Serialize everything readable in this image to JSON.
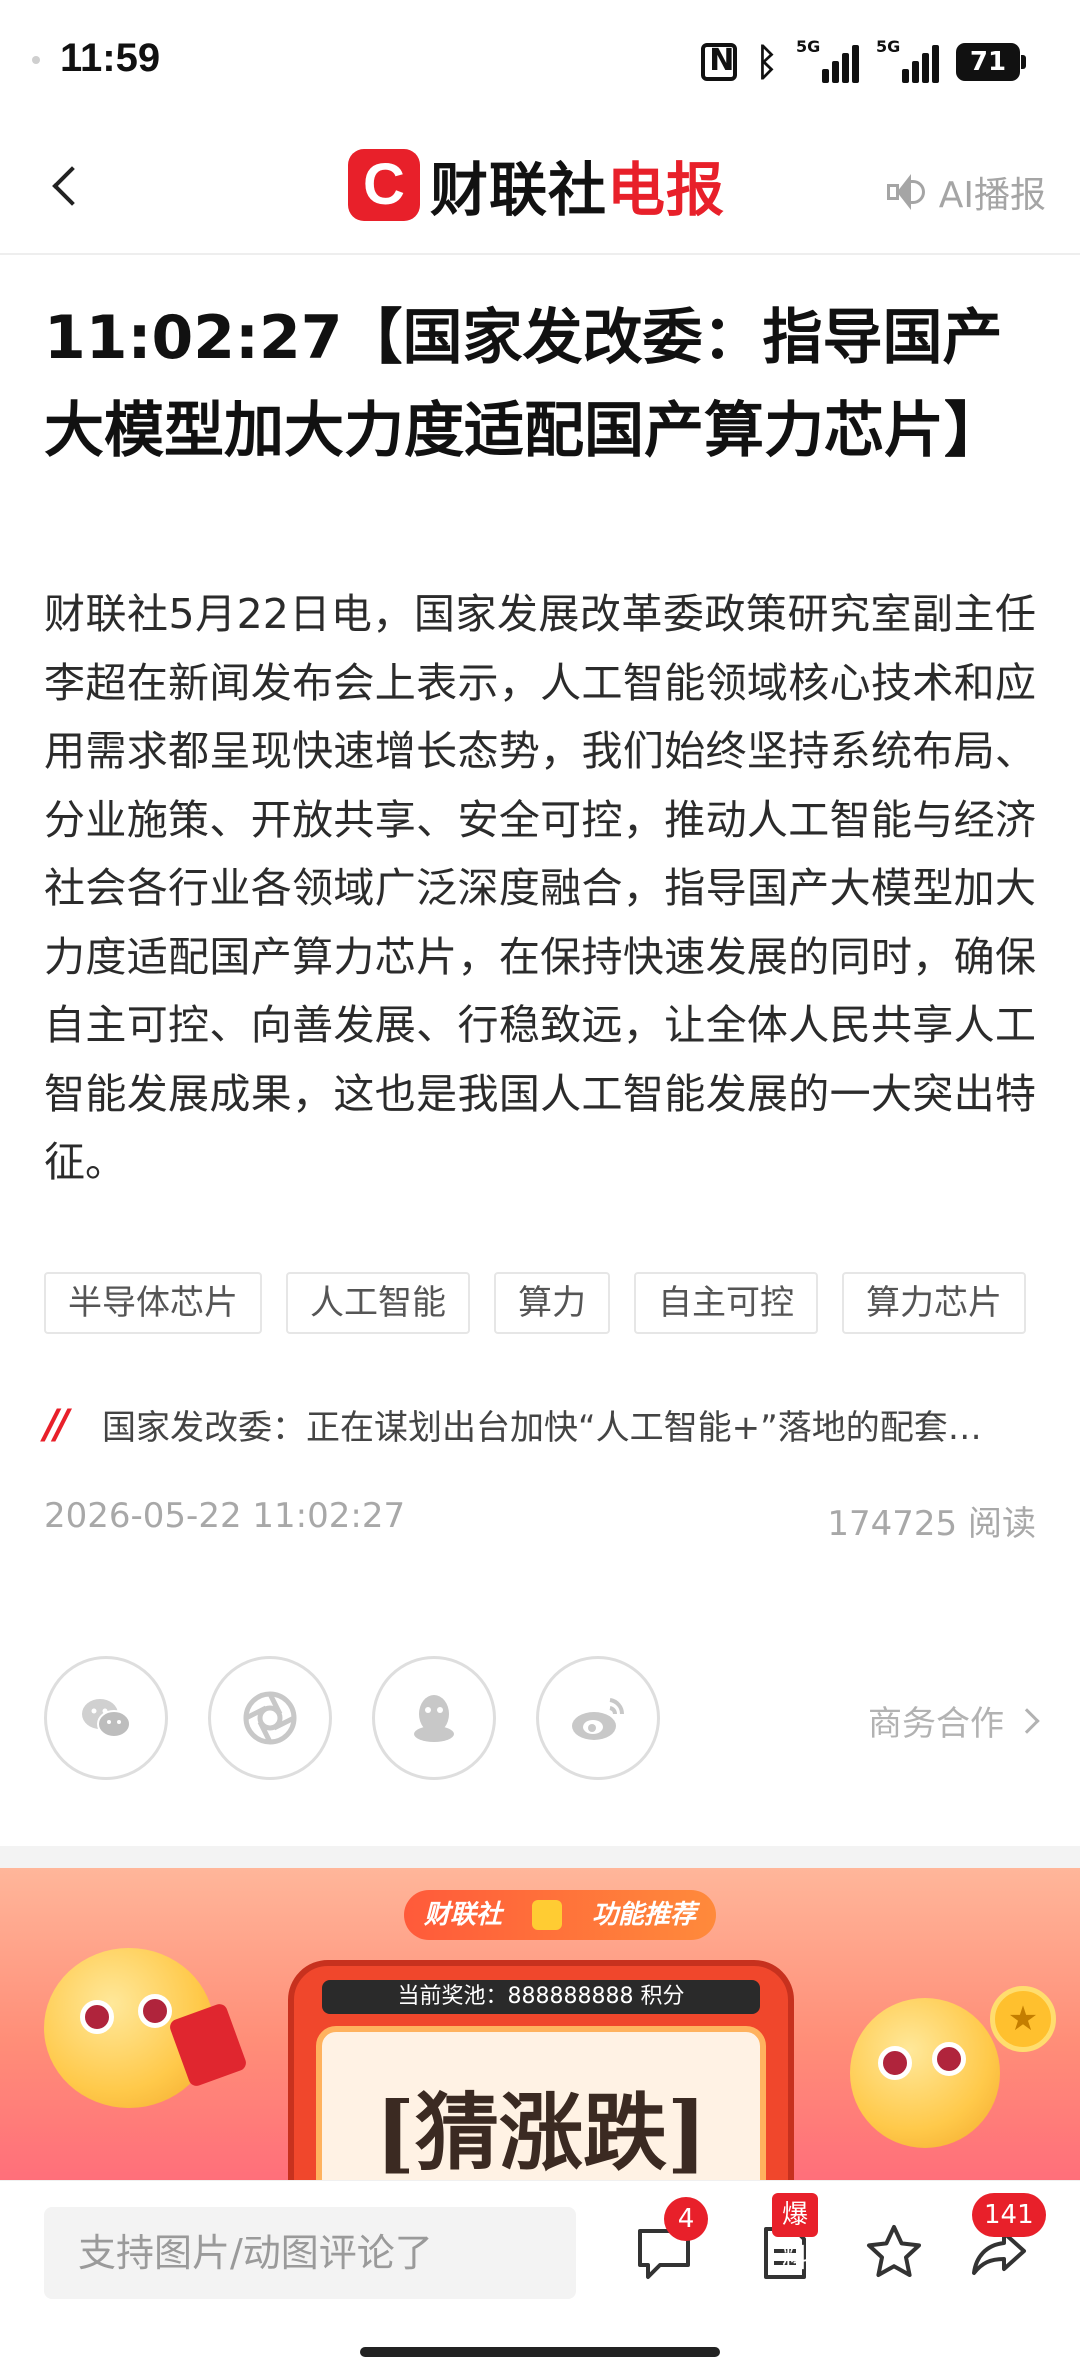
{
  "status_bar": {
    "time": "11:59",
    "network_1": "5G",
    "network_2": "5G",
    "battery": "71"
  },
  "header": {
    "logo_mark": "C",
    "logo_text_main": "财联社",
    "logo_text_accent": "电报",
    "ai_broadcast_label": "AI播报",
    "brand_color": "#e8202a"
  },
  "article": {
    "title": "11:02:27【国家发改委：指导国产大模型加大力度适配国产算力芯片】",
    "body": "财联社5月22日电，国家发展改革委政策研究室副主任李超在新闻发布会上表示，人工智能领域核心技术和应用需求都呈现快速增长态势，我们始终坚持系统布局、分业施策、开放共享、安全可控，推动人工智能与经济社会各行业各领域广泛深度融合，指导国产大模型加大力度适配国产算力芯片，在保持快速发展的同时，确保自主可控、向善发展、行稳致远，让全体人民共享人工智能发展成果，这也是我国人工智能发展的一大突出特征。",
    "tags": [
      "半导体芯片",
      "人工智能",
      "算力",
      "自主可控",
      "算力芯片"
    ],
    "related_icon": "//",
    "related_text": "国家发改委：正在谋划出台加快“人工智能+”落地的配套…",
    "datetime": "2026-05-22 11:02:27",
    "read_count": "174725 阅读"
  },
  "share": {
    "icons": [
      "wechat-icon",
      "moments-icon",
      "qq-icon",
      "weibo-icon"
    ],
    "business_label": "商务合作"
  },
  "banner": {
    "pill_brand": "财联社",
    "pill_feature": "功能推荐",
    "pool_text": "当前奖池：888888888 积分",
    "game_title": "[猜涨跌]"
  },
  "bottom_bar": {
    "comment_placeholder": "支持图片/动图评论了",
    "comment_count": "4",
    "report_badge": "爆料",
    "share_count": "141"
  }
}
